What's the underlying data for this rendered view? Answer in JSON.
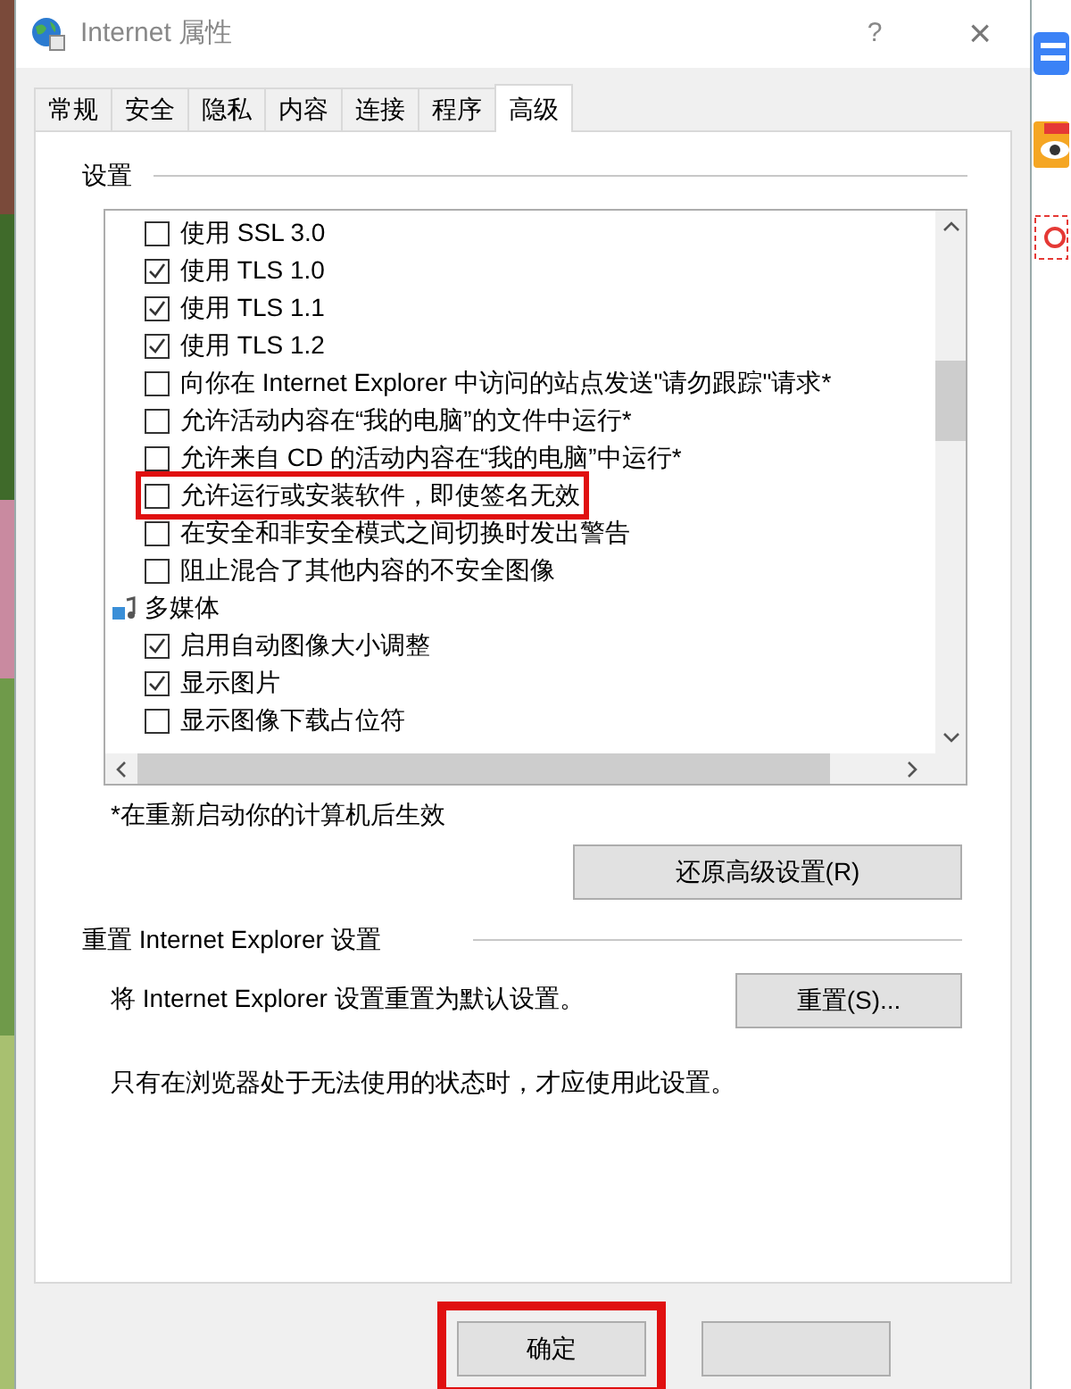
{
  "window": {
    "title": "Internet 属性",
    "help": "?",
    "close": "×"
  },
  "tabs": [
    {
      "label": "常规",
      "selected": false
    },
    {
      "label": "安全",
      "selected": false
    },
    {
      "label": "隐私",
      "selected": false
    },
    {
      "label": "内容",
      "selected": false
    },
    {
      "label": "连接",
      "selected": false
    },
    {
      "label": "程序",
      "selected": false
    },
    {
      "label": "高级",
      "selected": true
    }
  ],
  "settings": {
    "heading": "设置",
    "items": [
      {
        "kind": "checkbox",
        "label": "使用 SSL 3.0",
        "checked": false,
        "highlighted": false
      },
      {
        "kind": "checkbox",
        "label": "使用 TLS 1.0",
        "checked": true,
        "highlighted": false
      },
      {
        "kind": "checkbox",
        "label": "使用 TLS 1.1",
        "checked": true,
        "highlighted": false
      },
      {
        "kind": "checkbox",
        "label": "使用 TLS 1.2",
        "checked": true,
        "highlighted": false
      },
      {
        "kind": "checkbox",
        "label": "向你在 Internet Explorer 中访问的站点发送\"请勿跟踪\"请求*",
        "checked": false,
        "highlighted": false
      },
      {
        "kind": "checkbox",
        "label": "允许活动内容在“我的电脑”的文件中运行*",
        "checked": false,
        "highlighted": false
      },
      {
        "kind": "checkbox",
        "label": "允许来自 CD 的活动内容在“我的电脑”中运行*",
        "checked": false,
        "highlighted": false
      },
      {
        "kind": "checkbox",
        "label": "允许运行或安装软件，即使签名无效",
        "checked": false,
        "highlighted": true
      },
      {
        "kind": "checkbox",
        "label": "在安全和非安全模式之间切换时发出警告",
        "checked": false,
        "highlighted": false
      },
      {
        "kind": "checkbox",
        "label": "阻止混合了其他内容的不安全图像",
        "checked": false,
        "highlighted": false
      },
      {
        "kind": "group",
        "label": "多媒体",
        "children": [
          {
            "kind": "checkbox",
            "label": "启用自动图像大小调整",
            "checked": true,
            "highlighted": false
          },
          {
            "kind": "checkbox",
            "label": "显示图片",
            "checked": true,
            "highlighted": false
          },
          {
            "kind": "checkbox",
            "label": "显示图像下载占位符",
            "checked": false,
            "highlighted": false
          }
        ]
      }
    ],
    "footnote": "*在重新启动你的计算机后生效",
    "restore_button": "还原高级设置(R)"
  },
  "reset": {
    "heading": "重置 Internet Explorer 设置",
    "description": "将 Internet Explorer 设置重置为默认设置。",
    "button": "重置(S)...",
    "note": "只有在浏览器处于无法使用的状态时，才应使用此设置。"
  },
  "footer": {
    "buttons": [
      {
        "label": "确定",
        "highlighted": true
      }
    ]
  }
}
